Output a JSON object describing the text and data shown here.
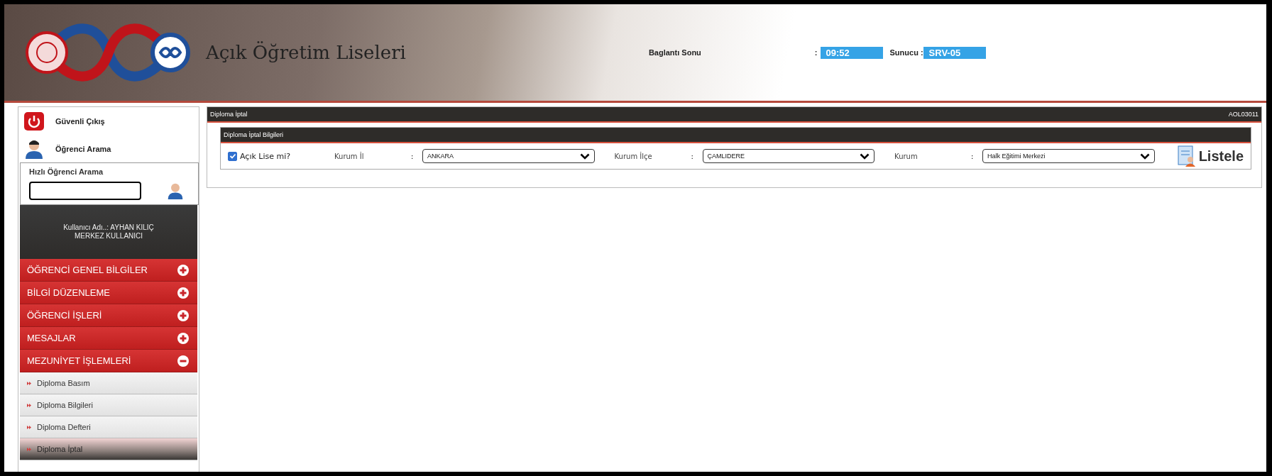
{
  "header": {
    "title": "Açık Öğretim Liseleri",
    "connection_label": "Baglantı Sonu",
    "connection_sep": ":",
    "connection_time": "09:52",
    "server_label": "Sunucu :",
    "server_value": "SRV-05"
  },
  "sidebar": {
    "actions": [
      {
        "kind": "logout",
        "label": "Güvenli Çıkış"
      },
      {
        "kind": "search",
        "label": "Öğrenci Arama"
      }
    ],
    "quick_search": {
      "title": "Hızlı Öğrenci Arama"
    },
    "user": {
      "line_1": "Kullanıcı Adı..: AYHAN KILIÇ",
      "line_2": "MERKEZ KULLANICI"
    },
    "menu": [
      {
        "label": "ÖĞRENCİ GENEL BİLGİLER",
        "expanded": false
      },
      {
        "label": "BİLGİ DÜZENLEME",
        "expanded": false
      },
      {
        "label": "ÖĞRENCİ İŞLERİ",
        "expanded": false
      },
      {
        "label": "MESAJLAR",
        "expanded": false
      },
      {
        "label": "MEZUNİYET İŞLEMLERİ",
        "expanded": true,
        "children": [
          {
            "label": "Diploma Basım",
            "selected": false
          },
          {
            "label": "Diploma Bilgileri",
            "selected": false
          },
          {
            "label": "Diploma Defteri",
            "selected": false
          },
          {
            "label": "Diploma İptal",
            "selected": true
          }
        ]
      }
    ]
  },
  "page": {
    "title": "Diploma İptal",
    "code": "AOL03011",
    "section_title": "Diploma İptal Bilgileri",
    "open_school": {
      "label": "Açık Lise mi?",
      "checked": true
    },
    "fields": [
      {
        "label": "Kurum İl",
        "sep": ":",
        "value": "ANKARA"
      },
      {
        "label": "Kurum İlçe",
        "sep": ":",
        "value": "ÇAMLIDERE"
      },
      {
        "label": "Kurum",
        "sep": ":",
        "value": "Halk Eğitimi Merkezi"
      }
    ],
    "list_button": "Listele"
  }
}
